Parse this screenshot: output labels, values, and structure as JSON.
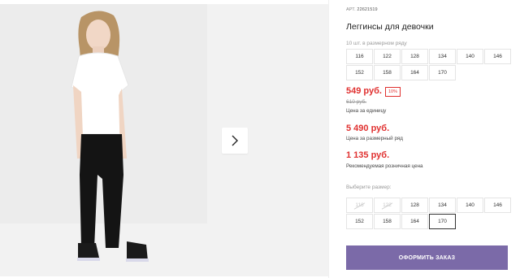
{
  "product": {
    "article_label": "АРТ.",
    "article_value": "22621519",
    "title": "Леггинсы для девочки",
    "row_note": "10 шт. в размерном ряду"
  },
  "sizes_row": [
    "116",
    "122",
    "128",
    "134",
    "140",
    "146",
    "152",
    "158",
    "164",
    "170"
  ],
  "pricing": {
    "unit_price": "549 руб.",
    "discount": "10%",
    "old_price": "610 руб.",
    "unit_label": "Цена за единицу",
    "row_price": "5 490 руб.",
    "row_label": "Цена за размерный ряд",
    "rrp_price": "1 135 руб.",
    "rrp_label": "Рекомендуемая розничная цена"
  },
  "size_select": {
    "label": "Выберите размер:",
    "options": [
      "116",
      "122",
      "128",
      "134",
      "140",
      "146",
      "152",
      "158",
      "164",
      "170"
    ],
    "disabled": [
      "116",
      "122"
    ],
    "selected": "170"
  },
  "order_button": "ОФОРМИТЬ ЗАКАЗ",
  "icons": {
    "next": "chevron-right-icon"
  },
  "colors": {
    "price": "#e0302f",
    "order_button": "#7b6aa8"
  }
}
